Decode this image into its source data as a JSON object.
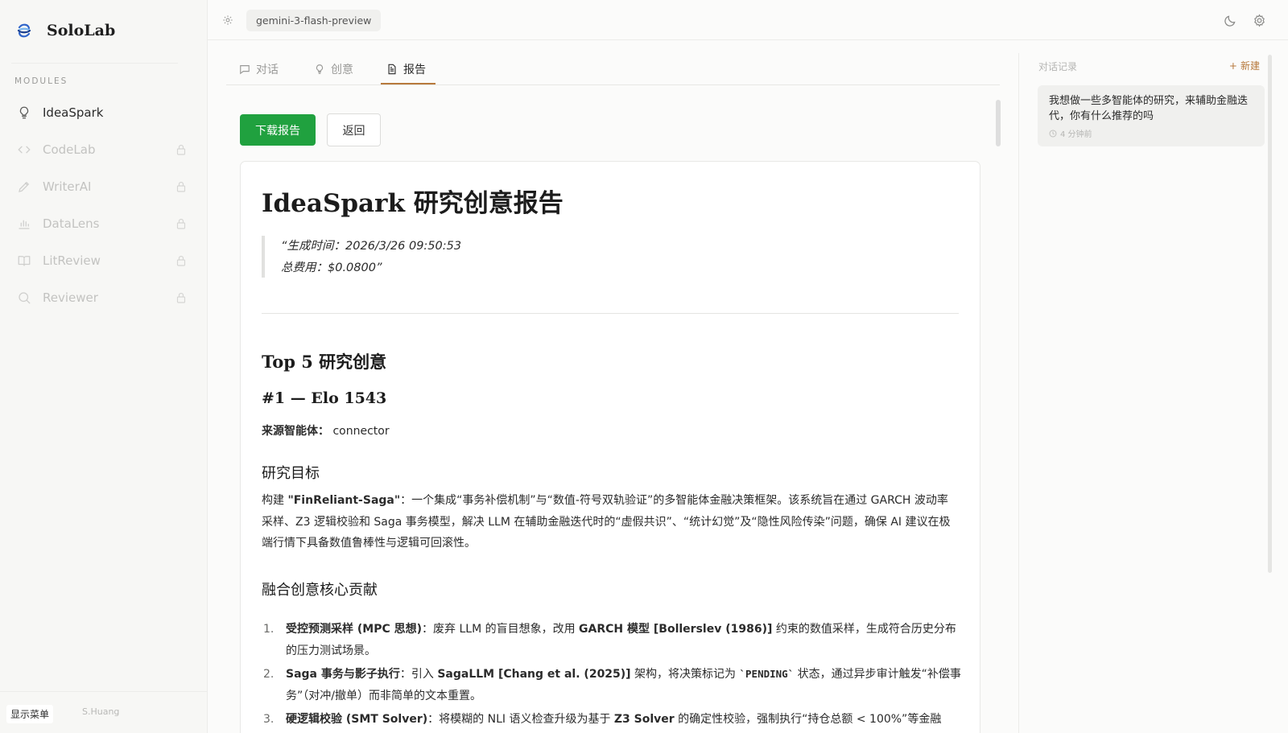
{
  "brand": {
    "name": "SoloLab"
  },
  "sidebar": {
    "section_label": "MODULES",
    "items": [
      {
        "label": "IdeaSpark",
        "icon": "lightbulb-icon",
        "locked": false
      },
      {
        "label": "CodeLab",
        "icon": "code-icon",
        "locked": true
      },
      {
        "label": "WriterAI",
        "icon": "pen-icon",
        "locked": true
      },
      {
        "label": "DataLens",
        "icon": "bar-chart-icon",
        "locked": true
      },
      {
        "label": "LitReview",
        "icon": "book-icon",
        "locked": true
      },
      {
        "label": "Reviewer",
        "icon": "search-icon",
        "locked": true
      }
    ],
    "menu_button": "显示菜单",
    "user": "S.Huang"
  },
  "topbar": {
    "model": "gemini-3-flash-preview"
  },
  "tabs": [
    {
      "label": "对话",
      "icon": "chat-icon",
      "active": false
    },
    {
      "label": "创意",
      "icon": "lightbulb-icon",
      "active": false
    },
    {
      "label": "报告",
      "icon": "document-icon",
      "active": true
    }
  ],
  "actions": {
    "download": "下载报告",
    "back": "返回"
  },
  "report": {
    "title": "IdeaSpark 研究创意报告",
    "quote_line1": "“生成时间：2026/3/26 09:50:53",
    "quote_line2": "总费用：$0.0800”",
    "section_title": "Top 5 研究创意",
    "idea_title": "#1 — Elo 1543",
    "source_label": "来源智能体：",
    "source_value": "connector",
    "goal_heading": "研究目标",
    "goal_prefix": "构建 ",
    "goal_name": "\"FinReliant-Saga\"",
    "goal_text": "：一个集成“事务补偿机制”与“数值-符号双轨验证”的多智能体金融决策框架。该系统旨在通过 GARCH 波动率采样、Z3 逻辑校验和 Saga 事务模型，解决 LLM 在辅助金融迭代时的“虚假共识”、“统计幻觉”及“隐性风险传染”问题，确保 AI 建议在极端行情下具备数值鲁棒性与逻辑可回滚性。",
    "contrib_heading": "融合创意核心贡献",
    "contributions": [
      {
        "num": "1.",
        "b1": "受控预测采样 (MPC 思想)",
        "t1": "：废弃 LLM 的盲目想象，改用 ",
        "b2": "GARCH 模型 [Bollerslev (1986)]",
        "t2": " 约束的数值采样，生成符合历史分布的压力测试场景。"
      },
      {
        "num": "2.",
        "b1": "Saga 事务与影子执行",
        "t1": "：引入 ",
        "b2": "SagaLLM [Chang et al. (2025)]",
        "t2": " 架构，将决策标记为 ",
        "code": "`PENDING`",
        "t3": " 状态，通过异步审计触发“补偿事务”（对冲/撤单）而非简单的文本重置。"
      },
      {
        "num": "3.",
        "b1": "硬逻辑校验 (SMT Solver)",
        "t1": "：将模糊的 NLI 语义检查升级为基于 ",
        "b2": "Z3 Solver",
        "t2": " 的确定性校验，强制执行“持仓总额 < 100%”等金融"
      }
    ]
  },
  "history": {
    "title": "对话记录",
    "new_label": "新建",
    "items": [
      {
        "text": "我想做一些多智能体的研究，来辅助金融迭代，你有什么推荐的吗",
        "time": "4 分钟前"
      }
    ]
  }
}
